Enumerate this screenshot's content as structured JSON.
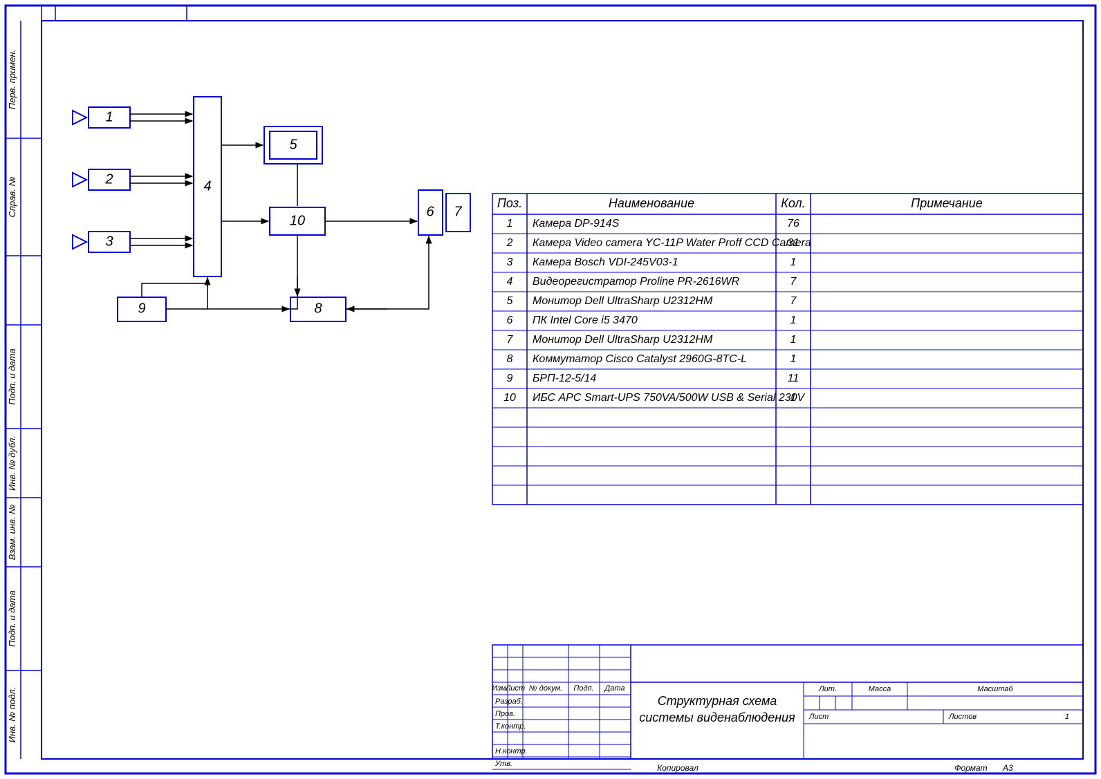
{
  "sidebar_labels": {
    "s1": "Перв. примен.",
    "s2": "Справ. №",
    "s3": "Подп. и дата",
    "s4": "Инв. № дубл.",
    "s5": "Взам. инв. №",
    "s6": "Подп. и дата",
    "s7": "Инв. № подл."
  },
  "parts_table": {
    "headers": {
      "pos": "Поз.",
      "name": "Наименование",
      "qty": "Кол.",
      "note": "Примечание"
    },
    "rows": [
      {
        "pos": "1",
        "name": "Камера DP-914S",
        "qty": "76",
        "note": ""
      },
      {
        "pos": "2",
        "name": "Камера Video camera YC-11P Water Proff CCD Camera",
        "qty": "31",
        "note": ""
      },
      {
        "pos": "3",
        "name": "Камера Bosch VDI-245V03-1",
        "qty": "1",
        "note": ""
      },
      {
        "pos": "4",
        "name": "Видеорегистратор Proline PR-2616WR",
        "qty": "7",
        "note": ""
      },
      {
        "pos": "5",
        "name": "Монитор Dell UltraSharp U2312HM",
        "qty": "7",
        "note": ""
      },
      {
        "pos": "6",
        "name": "ПК Intel Core i5 3470",
        "qty": "1",
        "note": ""
      },
      {
        "pos": "7",
        "name": "Монитор Dell UltraSharp U2312HM",
        "qty": "1",
        "note": ""
      },
      {
        "pos": "8",
        "name": "Коммутатор Cisco Catalyst 2960G-8TC-L",
        "qty": "1",
        "note": ""
      },
      {
        "pos": "9",
        "name": "БРП-12-5/14",
        "qty": "11",
        "note": ""
      },
      {
        "pos": "10",
        "name": "ИБС APC Smart-UPS 750VA/500W USB & Serial 230V",
        "qty": "1",
        "note": ""
      }
    ],
    "empty_rows": 5
  },
  "title_block": {
    "col_labels": {
      "izm": "Изм.",
      "list": "Лист",
      "ndoc": "№ докум.",
      "podp": "Подп.",
      "data": "Дата"
    },
    "row_labels": {
      "razrab": "Разраб.",
      "prov": "Пров.",
      "tkontr": "Т.контр.",
      "nkontr": "Н.контр.",
      "utv": "Утв."
    },
    "title_line1": "Структурная схема",
    "title_line2": "системы виденаблюдения",
    "lit": "Лит.",
    "massa": "Масса",
    "masshtab": "Масштаб",
    "list_label": "Лист",
    "listov_label": "Листов",
    "listov_value": "1"
  },
  "footer": {
    "kopiroval": "Копировал",
    "format_label": "Формат",
    "format_value": "А3"
  },
  "block_labels": {
    "b1": "1",
    "b2": "2",
    "b3": "3",
    "b4": "4",
    "b5": "5",
    "b6": "6",
    "b7": "7",
    "b8": "8",
    "b9": "9",
    "b10": "10"
  }
}
